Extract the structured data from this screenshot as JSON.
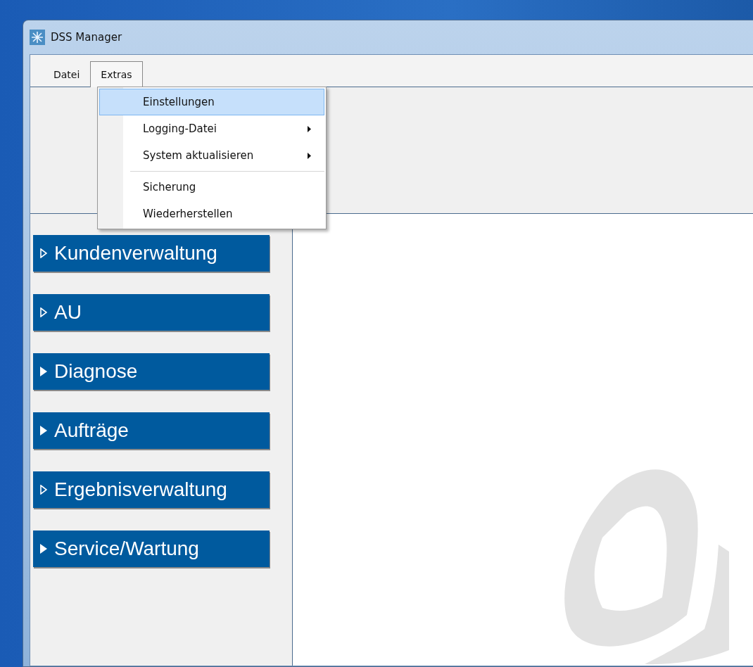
{
  "window": {
    "title": "DSS Manager"
  },
  "menu_bar": [
    {
      "label": "Datei",
      "selected": false
    },
    {
      "label": "Extras",
      "selected": true
    }
  ],
  "dropdown": {
    "items": [
      {
        "kind": "item",
        "label": "Einstellungen",
        "selected": true,
        "submenu": false
      },
      {
        "kind": "item",
        "label": "Logging-Datei",
        "selected": false,
        "submenu": true
      },
      {
        "kind": "item",
        "label": "System aktualisieren",
        "selected": false,
        "submenu": true
      },
      {
        "kind": "separator"
      },
      {
        "kind": "item",
        "label": "Sicherung",
        "selected": false,
        "submenu": false
      },
      {
        "kind": "item",
        "label": "Wiederherstellen",
        "selected": false,
        "submenu": false
      }
    ]
  },
  "sidebar": {
    "items": [
      {
        "label": "Kundenverwaltung",
        "kind": "hollow"
      },
      {
        "label": "AU",
        "kind": "hollow"
      },
      {
        "label": "Diagnose",
        "kind": "solid"
      },
      {
        "label": "Aufträge",
        "kind": "solid"
      },
      {
        "label": "Ergebnisverwaltung",
        "kind": "hollow"
      },
      {
        "label": "Service/Wartung",
        "kind": "solid"
      }
    ]
  }
}
